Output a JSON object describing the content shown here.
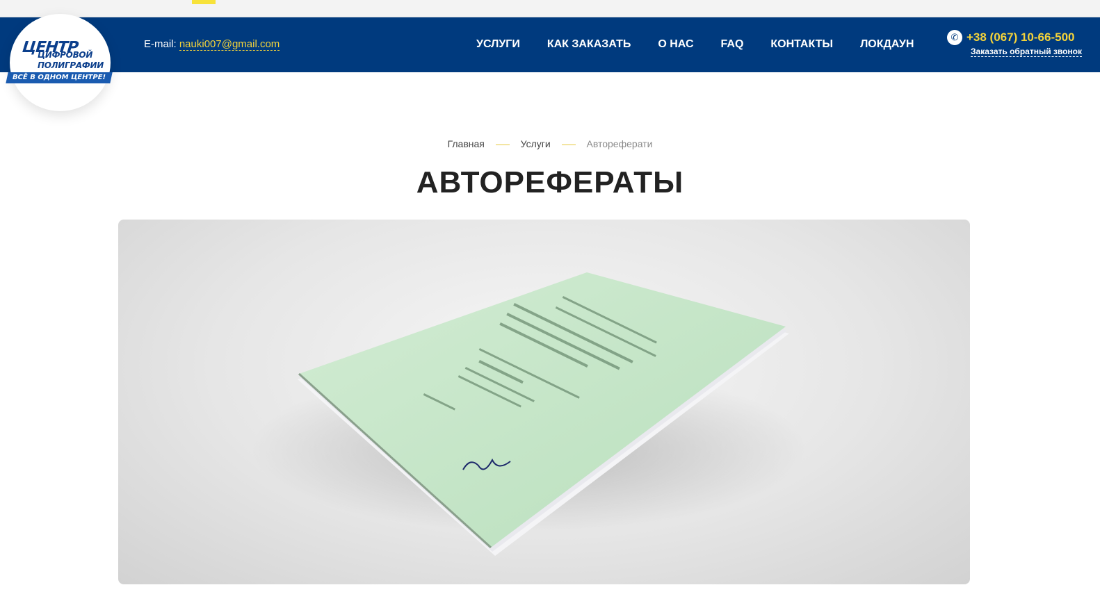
{
  "header": {
    "logo": {
      "line1": "ЦЕНТР",
      "line2": "ЦИФРОВОЙ",
      "line3": "ПОЛИГРАФИИ",
      "tagline": "ВСЁ В ОДНОМ ЦЕНТРЕ!"
    },
    "email_label": "E-mail:",
    "email": "nauki007@gmail.com",
    "nav": [
      "УСЛУГИ",
      "КАК ЗАКАЗАТЬ",
      "О НАС",
      "FAQ",
      "КОНТАКТЫ",
      "ЛОКДАУН"
    ],
    "phone": "+38 (067) 10-66-500",
    "callback_label": "Заказать обратный звонок"
  },
  "breadcrumb": [
    "Главная",
    "Услуги",
    "Автореферати"
  ],
  "page_title": "АВТОРЕФЕРАТЫ",
  "colors": {
    "navbar_bg": "#003a7e",
    "accent_yellow": "#f5d43a",
    "booklet_green": "#c6e6c8"
  },
  "icons": {
    "phone": "phone-icon"
  }
}
